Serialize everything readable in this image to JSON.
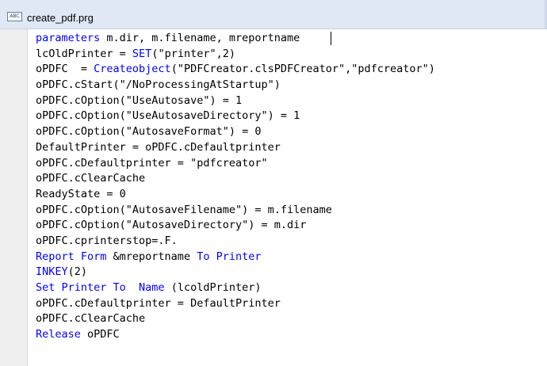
{
  "window": {
    "title": "create_pdf.prg",
    "icon": "ABC"
  },
  "colors": {
    "keyword": "#0000ff",
    "text": "#000000",
    "titlebar": "#dfe8f4",
    "gutter": "#efefef"
  },
  "code": {
    "lines": [
      [
        {
          "t": "parameters",
          "k": true
        },
        {
          "t": " m.dir, m.filename, mreportname",
          "k": false
        }
      ],
      [
        {
          "t": "lcOldPrinter = ",
          "k": false
        },
        {
          "t": "SET",
          "k": true
        },
        {
          "t": "(\"printer\",2)",
          "k": false
        }
      ],
      [
        {
          "t": "oPDFC  = ",
          "k": false
        },
        {
          "t": "Createobject",
          "k": true
        },
        {
          "t": "(\"PDFCreator.clsPDFCreator\",\"pdfcreator\")",
          "k": false
        }
      ],
      [
        {
          "t": "oPDFC.cStart(\"/NoProcessingAtStartup\")",
          "k": false
        }
      ],
      [
        {
          "t": "oPDFC.cOption(\"UseAutosave\") = 1",
          "k": false
        }
      ],
      [
        {
          "t": "oPDFC.cOption(\"UseAutosaveDirectory\") = 1",
          "k": false
        }
      ],
      [
        {
          "t": "oPDFC.cOption(\"AutosaveFormat\") = 0",
          "k": false
        }
      ],
      [
        {
          "t": "DefaultPrinter = oPDFC.cDefaultprinter",
          "k": false
        }
      ],
      [
        {
          "t": "oPDFC.cDefaultprinter = \"pdfcreator\"",
          "k": false
        }
      ],
      [
        {
          "t": "oPDFC.cClearCache",
          "k": false
        }
      ],
      [
        {
          "t": "ReadyState = 0",
          "k": false
        }
      ],
      [
        {
          "t": "oPDFC.cOption(\"AutosaveFilename\") = m.filename",
          "k": false
        }
      ],
      [
        {
          "t": "oPDFC.cOption(\"AutosaveDirectory\") = m.dir",
          "k": false
        }
      ],
      [
        {
          "t": "oPDFC.cprinterstop=.F.",
          "k": false
        }
      ],
      [
        {
          "t": "Report Form",
          "k": true
        },
        {
          "t": " &mreportname ",
          "k": false
        },
        {
          "t": "To Printer",
          "k": true
        }
      ],
      [
        {
          "t": "INKEY",
          "k": true
        },
        {
          "t": "(2)",
          "k": false
        }
      ],
      [
        {
          "t": "Set Printer To  Name",
          "k": true
        },
        {
          "t": " (lcoldPrinter)",
          "k": false
        }
      ],
      [
        {
          "t": "oPDFC.cDefaultprinter = DefaultPrinter",
          "k": false
        }
      ],
      [
        {
          "t": "oPDFC.cClearCache",
          "k": false
        }
      ],
      [
        {
          "t": "Release",
          "k": true
        },
        {
          "t": " oPDFC",
          "k": false
        }
      ]
    ]
  }
}
